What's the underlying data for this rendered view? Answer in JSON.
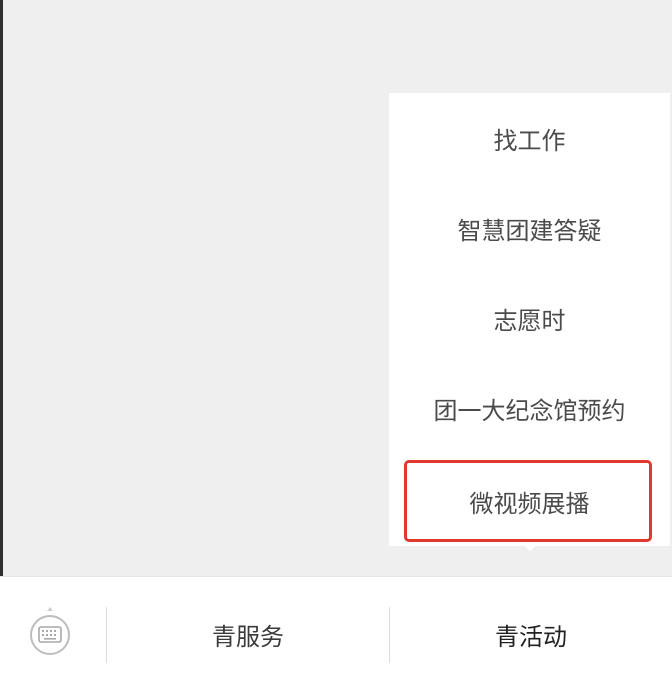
{
  "menu": {
    "items": [
      {
        "label": "找工作"
      },
      {
        "label": "智慧团建答疑"
      },
      {
        "label": "志愿时"
      },
      {
        "label": "团一大纪念馆预约"
      },
      {
        "label": "微视频展播"
      }
    ]
  },
  "bottom_bar": {
    "keyboard_icon": "keyboard-toggle-icon",
    "tabs": [
      {
        "label": "青服务"
      },
      {
        "label": "青活动"
      }
    ]
  },
  "colors": {
    "highlight": "#e03a30",
    "background": "#efefef",
    "text": "#4b4b4b"
  }
}
